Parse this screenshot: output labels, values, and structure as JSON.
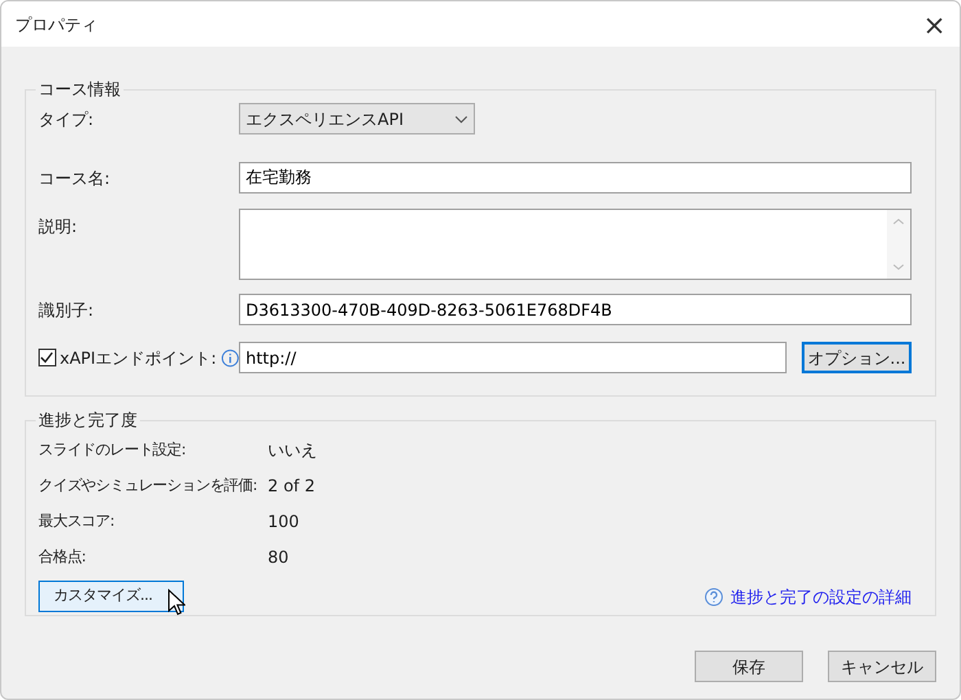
{
  "window": {
    "title": "プロパティ",
    "close": "×"
  },
  "course_info": {
    "title": "コース情報",
    "type": {
      "label": "タイプ:",
      "value": "エクスペリエンスAPI"
    },
    "name": {
      "label": "コース名:",
      "value": "在宅勤務"
    },
    "description": {
      "label": "説明:"
    },
    "identifier": {
      "label": "識別子:",
      "value": "D3613300-470B-409D-8263-5061E768DF4B"
    },
    "xapi_endpoint": {
      "label": "xAPIエンドポイント:",
      "checked": true,
      "value": "http://",
      "button": "オプション..."
    }
  },
  "progress": {
    "title": "進捗と完了度",
    "rows": [
      {
        "label": "スライドのレート設定:",
        "value": "いいえ"
      },
      {
        "label": "クイズやシミュレーションを評価:",
        "value": "2 of 2"
      },
      {
        "label": "最大スコア:",
        "value": "100"
      },
      {
        "label": "合格点:",
        "value": "80"
      }
    ],
    "customize_button": "カスタマイズ...",
    "help_link": "進捗と完了の設定の詳細"
  },
  "buttons": [
    "保存",
    "キャンセル"
  ]
}
